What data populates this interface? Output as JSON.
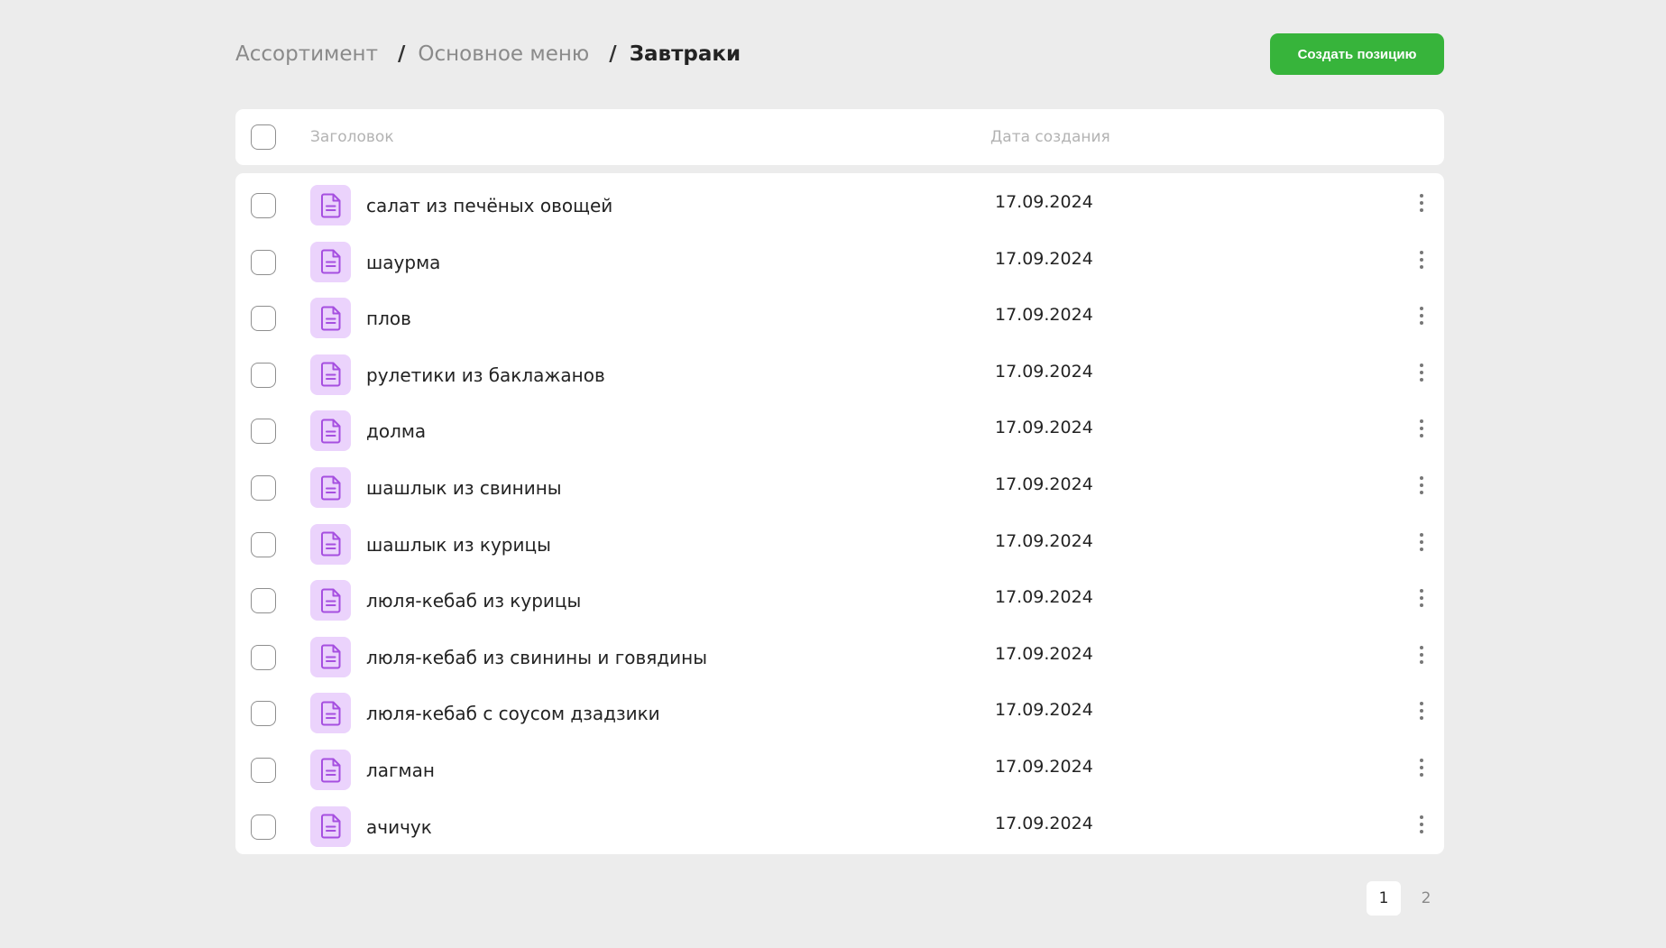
{
  "breadcrumb": {
    "items": [
      "Ассортимент",
      "Основное меню"
    ],
    "separator": "/",
    "current": "Завтраки"
  },
  "header": {
    "create_button_label": "Создать позицию"
  },
  "table": {
    "columns": {
      "title": "Заголовок",
      "date": "Дата создания"
    },
    "rows": [
      {
        "title": "салат из печёных овощей",
        "date": "17.09.2024"
      },
      {
        "title": "шаурма",
        "date": "17.09.2024"
      },
      {
        "title": "плов",
        "date": "17.09.2024"
      },
      {
        "title": "рулетики из баклажанов",
        "date": "17.09.2024"
      },
      {
        "title": "долма",
        "date": "17.09.2024"
      },
      {
        "title": "шашлык из свинины",
        "date": "17.09.2024"
      },
      {
        "title": "шашлык из курицы",
        "date": "17.09.2024"
      },
      {
        "title": "люля-кебаб из курицы",
        "date": "17.09.2024"
      },
      {
        "title": "люля-кебаб из свинины и говядины",
        "date": "17.09.2024"
      },
      {
        "title": "люля-кебаб с соусом дзадзики",
        "date": "17.09.2024"
      },
      {
        "title": "лагман",
        "date": "17.09.2024"
      },
      {
        "title": "ачичук",
        "date": "17.09.2024"
      }
    ],
    "row_icon": "document-icon",
    "row_menu_icon": "more-vertical-icon"
  },
  "pagination": {
    "pages": [
      "1",
      "2"
    ],
    "current": "1"
  },
  "colors": {
    "background": "#ececec",
    "accent_button": "#37b43b",
    "icon_bg": "#ebd3fc",
    "icon_stroke": "#a64fe0"
  }
}
